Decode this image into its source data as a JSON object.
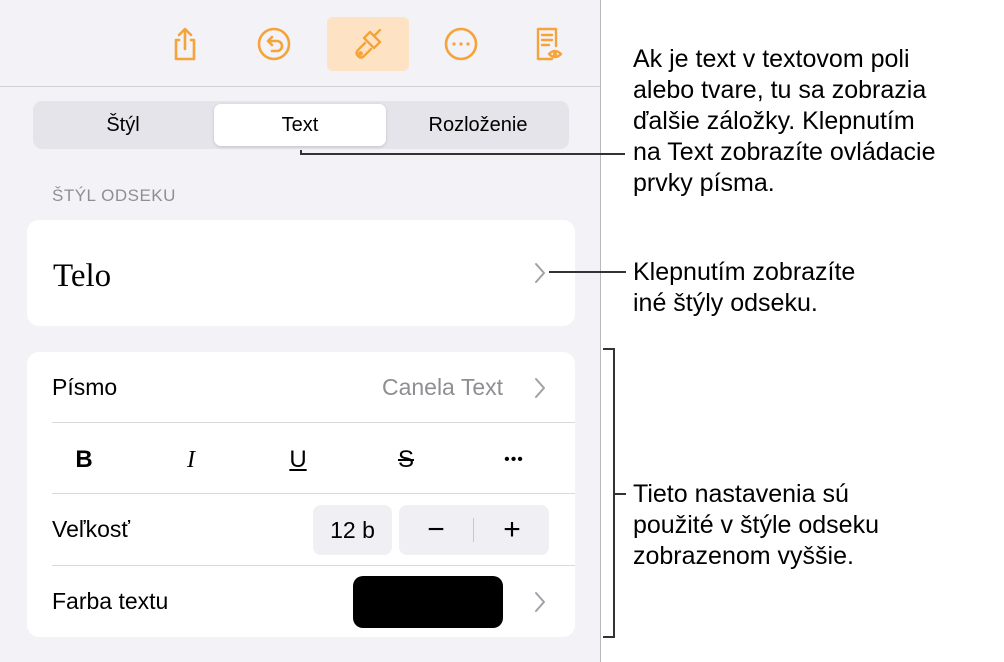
{
  "toolbar": {
    "share_icon": "share-icon",
    "undo_icon": "undo-icon",
    "format_icon": "paintbrush-icon",
    "more_icon": "more-icon",
    "document_icon": "document-icon",
    "accent": "#f5a33a"
  },
  "tabs": [
    {
      "label": "Štýl"
    },
    {
      "label": "Text"
    },
    {
      "label": "Rozloženie"
    }
  ],
  "selected_tab": "Text",
  "paragraph_style": {
    "section_label": "ŠTÝL ODSEKU",
    "name": "Telo"
  },
  "font": {
    "label": "Písmo",
    "value": "Canela Text"
  },
  "format_buttons": {
    "bold": "B",
    "italic": "I",
    "underline": "U",
    "strikethrough": "S",
    "more": "•••"
  },
  "size": {
    "label": "Veľkosť",
    "value": "12 b",
    "decrement": "−",
    "increment": "+"
  },
  "text_color": {
    "label": "Farba textu",
    "swatch": "#000000"
  },
  "callouts": {
    "tabs": [
      "Ak je text v textovom poli",
      "alebo tvare, tu sa zobrazia",
      "ďalšie záložky. Klepnutím",
      "na Text zobrazíte ovládacie",
      "prvky písma."
    ],
    "style": [
      "Klepnutím zobrazíte",
      "iné štýly odseku."
    ],
    "settings": [
      "Tieto nastavenia sú",
      "použité v štýle odseku",
      "zobrazenom vyššie."
    ]
  }
}
